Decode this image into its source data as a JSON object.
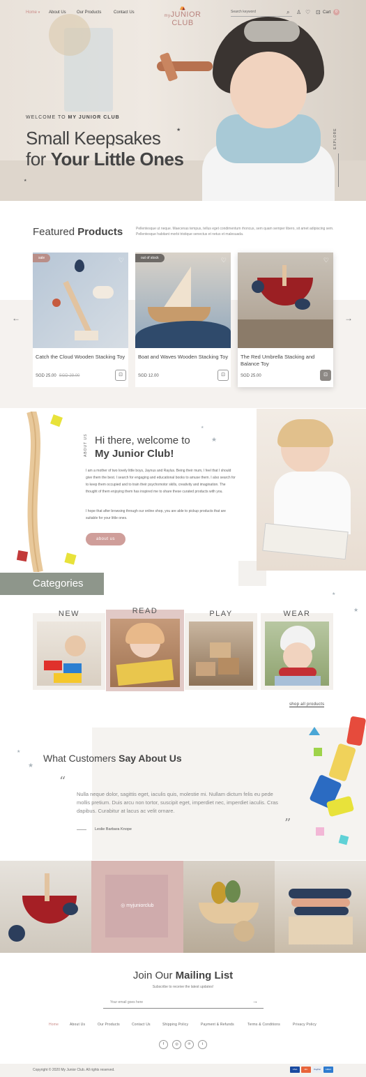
{
  "nav": {
    "links": [
      "Home",
      "About Us",
      "Our Products",
      "Contact Us"
    ],
    "home_caret": "▾",
    "logo": "JUNIOR CLUB",
    "logo_prefix": "my",
    "search_placeholder": "Search keyword",
    "cart_label": "Cart",
    "cart_count": "0"
  },
  "hero": {
    "eyebrow_prefix": "WELCOME TO ",
    "eyebrow_brand": "MY JUNIOR CLUB",
    "title_line1": "Small Keepsakes",
    "title_line2_prefix": "for ",
    "title_line2_bold": "Your Little Ones",
    "explore": "EXPLORE"
  },
  "featured": {
    "title_light": "Featured ",
    "title_bold": "Products",
    "description": "Pellentesque ut neque. Maecenas tempus, tellus eget condimentum rhoncus, sem quam semper libero, sit amet adipiscing sem. Pellentesque habitant morbi tristique senectus et netus et malesuada.",
    "prev_arrow": "←",
    "next_arrow": "→",
    "products": [
      {
        "tag": "sale",
        "name": "Catch the Cloud Wooden Stacking Toy",
        "price": "SGD 25.00",
        "old_price": "SGD 29.00"
      },
      {
        "tag": "out of stock",
        "name": "Boat and Waves Wooden Stacking Toy",
        "price": "SGD 12.00",
        "old_price": ""
      },
      {
        "tag": "",
        "name": "The Red Umbrella Stacking and  Balance Toy",
        "price": "SGD 25.00",
        "old_price": ""
      }
    ]
  },
  "about": {
    "label": "ABOUT US",
    "title_line1": "Hi there, welcome to",
    "title_line2": "My Junior Club!",
    "paragraph1": "I am a mother of two lovely little boys, Jaynus and Raylus. Being their mum, I feel that I should give them the best. I search for engaging and educational books to amuse them. I also search for to keep them occupied and to train their psychomotor skills, creativity and imagination. The thought of them enjoying them has inspired me to share these curated products with you.",
    "paragraph2": "I hope that after browsing through our online shop, you are able to pickup products that are suitable for your little ones.",
    "button": "about us"
  },
  "categories": {
    "title": "Categories",
    "items": [
      "NEW",
      "READ",
      "PLAY",
      "WEAR"
    ],
    "shop_all": "shop all products"
  },
  "testimonial": {
    "title_light": "What Customers ",
    "title_bold": "Say About Us",
    "quote_open": "“",
    "quote_close": "”",
    "text": "Nulla neque dolor, sagittis eget, iaculis quis, molestie mi. Nullam dictum felis eu pede mollis pretium. Duis arcu non tortor, suscipit eget, imperdiet nec, imperdiet iaculis. Cras dapibus. Curabitur at lacus ac velit ornare.",
    "author": "Leslie Barbara Knope"
  },
  "instagram": {
    "handle": "myjuniorclub"
  },
  "mailing": {
    "title_light": "Join Our ",
    "title_bold": "Mailing List",
    "subtitle": "Subscribe to receive the latest updates!",
    "placeholder": "Your email goes here",
    "submit": "→"
  },
  "footer": {
    "links": [
      "Home",
      "About Us",
      "Our Products",
      "Contact Us",
      "Shipping Policy",
      "Payment & Refunds",
      "Terms & Conditions",
      "Privacy Policy"
    ],
    "social": [
      "f",
      "◎",
      "℗",
      "t"
    ],
    "copyright": "Copyright © 2020 My Junior Club. All rights reserved.",
    "payments": [
      "VISA",
      "MC",
      "PayPal",
      "AMEX"
    ]
  },
  "colors": {
    "accent": "#c98a86",
    "button": "#cf9e9a",
    "category_band": "#8e968b"
  }
}
